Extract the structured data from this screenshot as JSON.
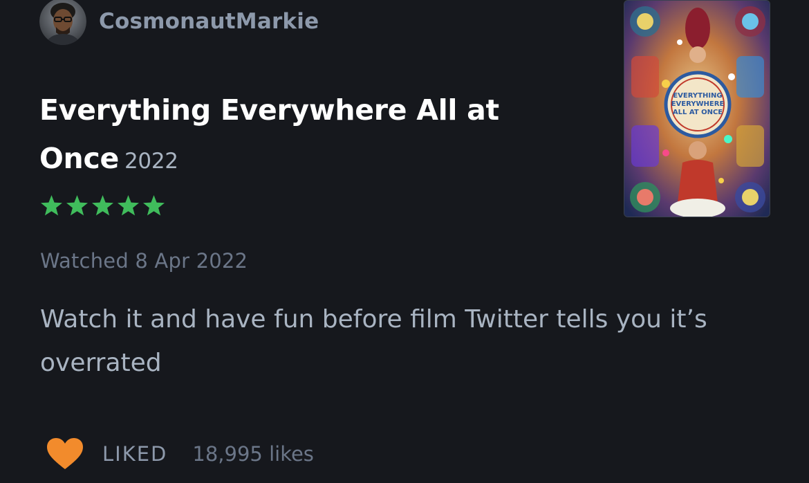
{
  "review": {
    "author": {
      "username": "CosmonautMarkie",
      "avatar_icon": "avatar"
    },
    "film": {
      "title": "Everything Everywhere All at Once",
      "year": "2022",
      "poster_text": "EVERYTHING EVERYWHERE ALL AT ONCE"
    },
    "rating": {
      "stars": 5,
      "max": 5,
      "color": "#40bc5c"
    },
    "watched": "Watched 8 Apr 2022",
    "body": "Watch it and have fun before film Twitter tells you it’s overrated",
    "liked_label": "LIKED",
    "likes_count": "18,995 likes",
    "heart_color": "#f28b2c"
  },
  "colors": {
    "background": "#16181d",
    "title": "#ffffff",
    "muted": "#8d99ab"
  }
}
